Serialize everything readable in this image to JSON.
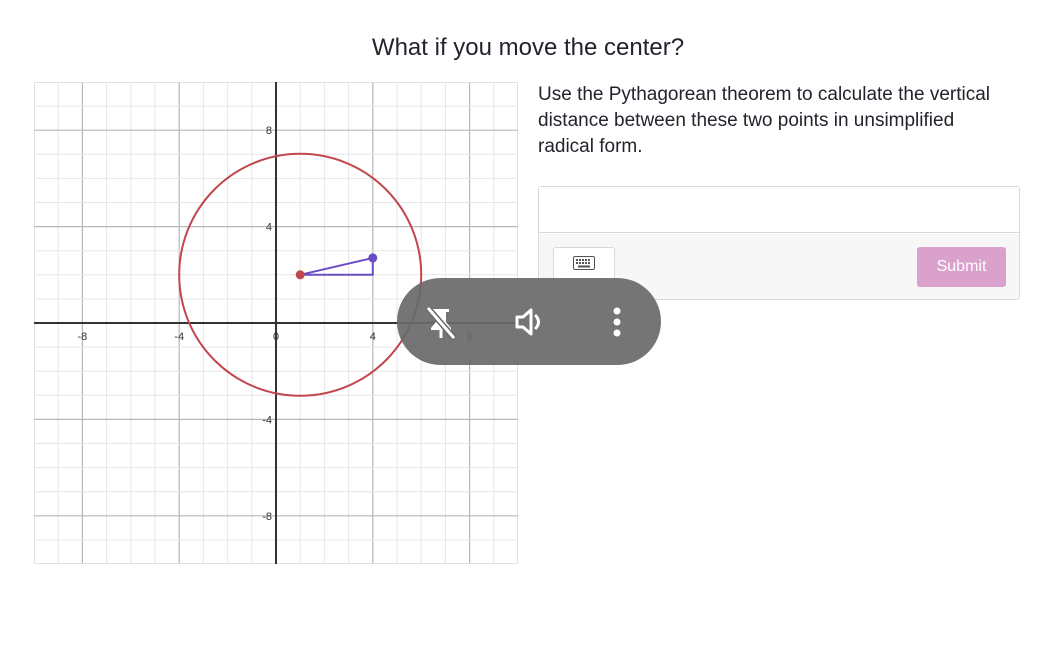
{
  "question": {
    "title": "What if you move the center?",
    "prompt": "Use the Pythagorean theorem to calculate the vertical distance between these two points in unsimplified radical form."
  },
  "answer": {
    "value": "",
    "keypad_icon": "keyboard-icon",
    "submit_label": "Submit",
    "submit_color": "#dba1cd"
  },
  "graph": {
    "x_range": [
      -10,
      10
    ],
    "y_range": [
      -10,
      10
    ],
    "tick_labels_x": [
      "-8",
      "-4",
      "0",
      "4",
      "8"
    ],
    "tick_labels_y": [
      "8",
      "4",
      "-4",
      "-8"
    ],
    "circle": {
      "center": [
        1,
        2
      ],
      "radius": 5,
      "color": "#c0474d"
    },
    "points": [
      {
        "name": "center",
        "x": 1,
        "y": 2,
        "color": "#c0474d"
      },
      {
        "name": "point-on-circle",
        "x": 4,
        "y": 2.7,
        "color": "#6a4bc4"
      }
    ],
    "triangle_color": "#6a4bc4"
  },
  "video_overlay": {
    "icons": [
      "pin-off-icon",
      "volume-icon",
      "more-vertical-icon"
    ]
  }
}
